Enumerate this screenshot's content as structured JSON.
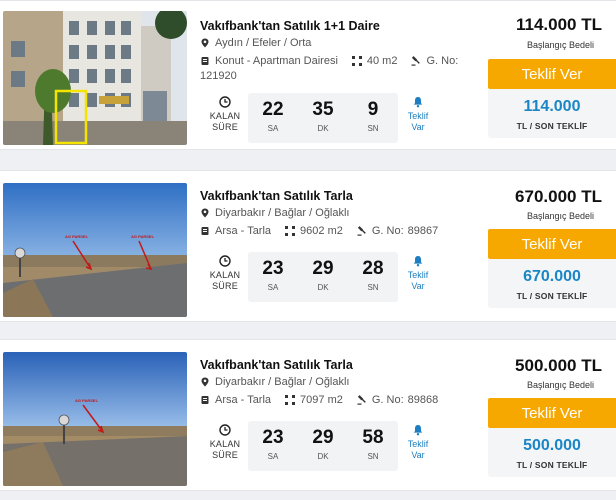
{
  "listings": [
    {
      "title": "Vakıfbank'tan Satılık 1+1 Daire",
      "location": "Aydın / Efeler / Orta",
      "type": "Konut - Apartman Dairesi",
      "area": "40 m2",
      "gno_label": "G. No:",
      "gno": "121920",
      "countdown": {
        "hours": "22",
        "minutes": "35",
        "seconds": "9"
      },
      "price": "114.000 TL",
      "price_label": "Başlangıç Bedeli",
      "bid_button": "Teklif Ver",
      "last_bid": "114.000",
      "last_bid_label": "TL / SON TEKLİF"
    },
    {
      "title": "Vakıfbank'tan Satılık Tarla",
      "location": "Diyarbakır / Bağlar / Oğlaklı",
      "type": "Arsa - Tarla",
      "area": "9602 m2",
      "gno_label": "G. No:",
      "gno": "89867",
      "countdown": {
        "hours": "23",
        "minutes": "29",
        "seconds": "28"
      },
      "price": "670.000 TL",
      "price_label": "Başlangıç Bedeli",
      "bid_button": "Teklif Ver",
      "last_bid": "670.000",
      "last_bid_label": "TL / SON TEKLİF"
    },
    {
      "title": "Vakıfbank'tan Satılık Tarla",
      "location": "Diyarbakır / Bağlar / Oğlaklı",
      "type": "Arsa - Tarla",
      "area": "7097 m2",
      "gno_label": "G. No:",
      "gno": "89868",
      "countdown": {
        "hours": "23",
        "minutes": "29",
        "seconds": "58"
      },
      "price": "500.000 TL",
      "price_label": "Başlangıç Bedeli",
      "bid_button": "Teklif Ver",
      "last_bid": "500.000",
      "last_bid_label": "TL / SON TEKLİF"
    }
  ],
  "labels": {
    "remaining_line1": "KALAN",
    "remaining_line2": "SÜRE",
    "unit_hours": "SA",
    "unit_minutes": "DK",
    "unit_seconds": "SN",
    "bid_count_line1": "Teklif",
    "bid_count_line2": "Var"
  },
  "photo_markers": [
    "AG PARSEL",
    "AG PARSEL"
  ],
  "photo_marker_single": "AG PARSEL",
  "icons": {
    "location": "map-pin-icon",
    "property": "building-icon",
    "area": "area-corners-icon",
    "gno": "gavel-icon",
    "timer": "clock-icon",
    "bids": "bell-icon"
  },
  "colors": {
    "bid_button": "#f7a800",
    "last_bid": "#1b86c6",
    "bid_count": "#1d7fc1"
  }
}
